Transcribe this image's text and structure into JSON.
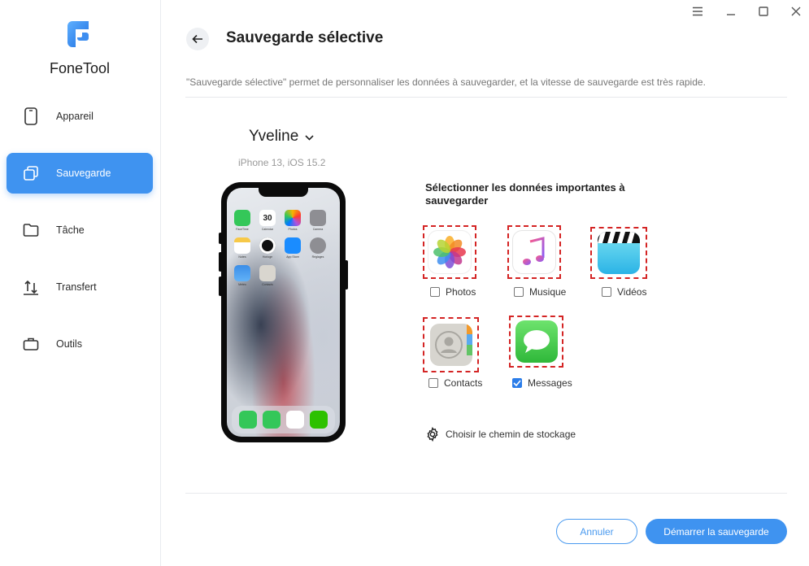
{
  "app": {
    "name": "FoneTool",
    "accent": "#3f93f0"
  },
  "window_controls": [
    {
      "icon": "menu-icon"
    },
    {
      "icon": "minimize-icon"
    },
    {
      "icon": "maximize-icon"
    },
    {
      "icon": "close-icon"
    }
  ],
  "sidebar": {
    "items": [
      {
        "label": "Appareil",
        "icon": "phone-icon",
        "active": false
      },
      {
        "label": "Sauvegarde",
        "icon": "backup-icon",
        "active": true
      },
      {
        "label": "Tâche",
        "icon": "folder-icon",
        "active": false
      },
      {
        "label": "Transfert",
        "icon": "transfer-icon",
        "active": false
      },
      {
        "label": "Outils",
        "icon": "toolbox-icon",
        "active": false
      }
    ]
  },
  "header": {
    "title": "Sauvegarde sélective",
    "description": "\"Sauvegarde sélective\" permet de personnaliser les données à sauvegarder, et la vitesse de sauvegarde est très rapide."
  },
  "device": {
    "name": "Yveline",
    "info": "iPhone 13, iOS 15.2",
    "home_apps": [
      "FaceTime",
      "Calendar",
      "Photos",
      "Camera",
      "Notes",
      "Horloge",
      "App Store",
      "Réglages",
      "Météo",
      "Contacts"
    ]
  },
  "selection": {
    "title": "Sélectionner les données importantes à sauvegarder",
    "options": [
      {
        "label": "Photos",
        "icon": "photos-icon",
        "checked": false
      },
      {
        "label": "Musique",
        "icon": "music-icon",
        "checked": false
      },
      {
        "label": "Vidéos",
        "icon": "videos-icon",
        "checked": false
      },
      {
        "label": "Contacts",
        "icon": "contacts-icon",
        "checked": false
      },
      {
        "label": "Messages",
        "icon": "messages-icon",
        "checked": true
      }
    ]
  },
  "storage": {
    "label": "Choisir le chemin de stockage",
    "icon": "gear-icon"
  },
  "footer": {
    "cancel_label": "Annuler",
    "start_label": "Démarrer la sauvegarde"
  }
}
